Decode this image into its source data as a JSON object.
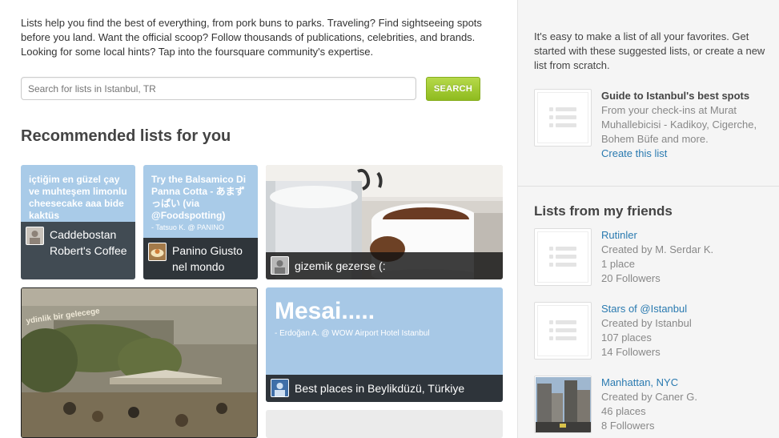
{
  "intro": "Lists help you find the best of everything, from pork buns to parks. Traveling? Find sightseeing spots before you land. Want the official scoop? Follow thousands of publications, celebrities, and brands. Looking for some local hints? Tap into the foursquare community's expertise.",
  "search": {
    "placeholder": "Search for lists in Istanbul, TR",
    "button": "SEARCH"
  },
  "recommended_title": "Recommended lists for you",
  "tiles": [
    {
      "overlay": "içtiğim en güzel çay ve muhteşem limonlu cheesecake aaa bide kaktüs",
      "name": "Caddebostan Robert's Coffee"
    },
    {
      "overlay": "Try the Balsamico Di Panna Cotta - あまずっぱい (via @Foodspotting)",
      "credit": "- Tatsuo K. @ PANINO",
      "name": "Panino Giusto nel mondo"
    },
    {
      "name": "gizemik gezerse (:"
    },
    {
      "name": ""
    },
    {
      "title": "Mesai.....",
      "credit": "- Erdoğan A. @ WOW Airport Hotel Istanbul",
      "name": "Best places in Beylikdüzü, Türkiye"
    }
  ],
  "sidebar": {
    "intro": "It's easy to make a list of all your favorites. Get started with these suggested lists, or create a new list from scratch.",
    "guide": {
      "title": "Guide to Istanbul's best spots",
      "desc": "From your check-ins at Murat Muhallebicisi - Kadikoy, Cigerche, Bohem Büfe and more.",
      "link": "Create this list"
    },
    "friends_title": "Lists from my friends",
    "friends": [
      {
        "name": "Rutinler",
        "creator": "Created by M. Serdar K.",
        "places": "1 place",
        "followers": "20 Followers"
      },
      {
        "name": "Stars of @Istanbul",
        "creator": "Created by Istanbul",
        "places": "107 places",
        "followers": "14 Followers"
      },
      {
        "name": "Manhattan, NYC",
        "creator": "Created by Caner G.",
        "places": "46 places",
        "followers": "8 Followers"
      }
    ]
  }
}
